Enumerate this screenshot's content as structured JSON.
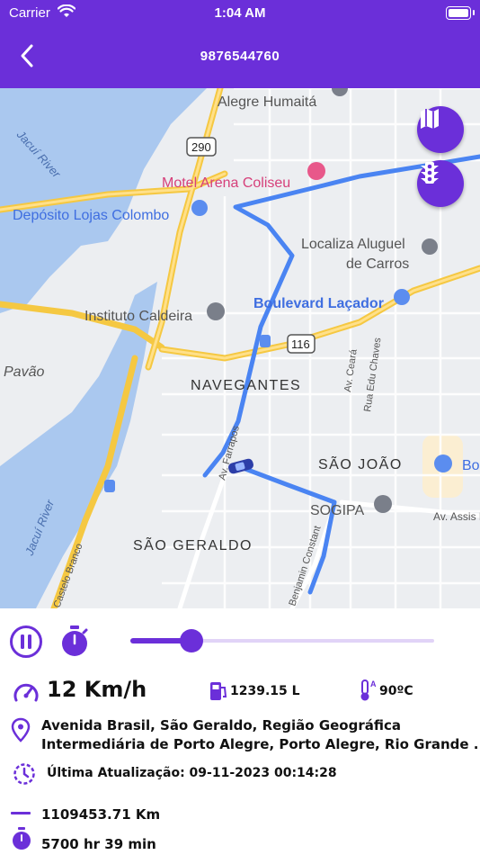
{
  "status_bar": {
    "carrier": "Carrier",
    "time": "1:04 AM"
  },
  "header": {
    "title": "9876544760",
    "back_icon": "chevron-left-icon"
  },
  "map": {
    "labels": {
      "alegre_humaita": "Alegre Humaitá",
      "motel": "Motel Arena Coliseu",
      "deposito": "Depósito Lojas Colombo",
      "localiza1": "Localiza Aluguel",
      "localiza2": "de Carros",
      "boulevard": "Boulevard Laçador",
      "instituto": "Instituto Caldeira",
      "pavao": "Pavão",
      "navegantes": "NAVEGANTES",
      "sao_joao": "SÃO JOÃO",
      "sogipa": "SOGIPA",
      "sao_geraldo": "SÃO GERALDO",
      "jacui1": "Jacuí River",
      "jacui2": "Jacuí River",
      "av_ceara": "Av. Ceará",
      "rua_edu": "Rua Edu Chaves",
      "av_farrapos": "Av. Farrapos",
      "av_assis": "Av. Assis B",
      "benjamin": "Benjamin Constant",
      "castelo": "Castelo Branco",
      "bo": "Bo",
      "route290": "290",
      "route116": "116"
    },
    "buttons": {
      "map_type_icon": "map-icon",
      "traffic_icon": "traffic-light-icon"
    },
    "colors": {
      "route": "#4a84f2",
      "accent": "#6b2fd9",
      "water": "#a9c8f0",
      "highway": "#f7c948"
    }
  },
  "playback": {
    "pause_icon": "pause-icon",
    "timer_icon": "stopwatch-icon",
    "progress": 0.2
  },
  "info": {
    "speed": "12 Km/h",
    "fuel": "1239.15 L",
    "temperature": "90ºC",
    "address_line1": "Avenida Brasil, São Geraldo, Região Geográfica",
    "address_line2": "Intermediária de Porto Alegre, Porto Alegre, Rio Grande ...",
    "last_update": "Última Atualização: 09-11-2023 00:14:28",
    "distance": "1109453.71 Km",
    "duration": "5700 hr 39 min"
  }
}
